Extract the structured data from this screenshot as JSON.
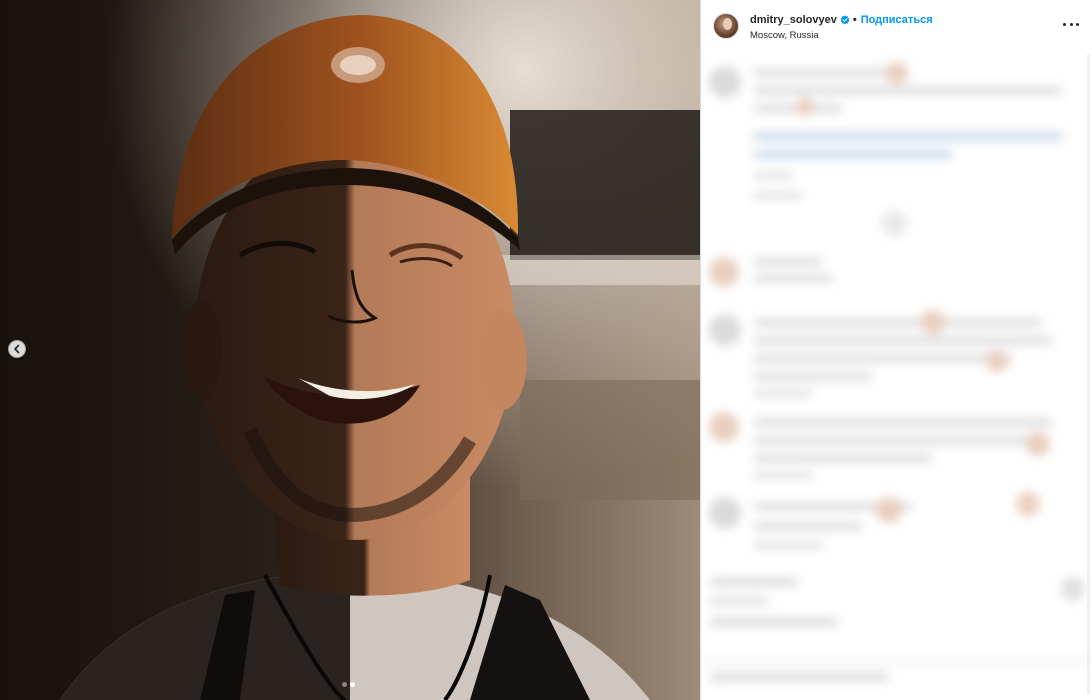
{
  "post": {
    "username": "dmitry_solovyev",
    "separator": "•",
    "follow_label": "Подписаться",
    "location": "Moscow, Russia"
  },
  "carousel": {
    "slide_count": 2,
    "active_slide": 2
  },
  "colors": {
    "accent": "#0095f6",
    "text": "#262626",
    "border": "#dbdbdb"
  },
  "icons": {
    "verified": "verified-badge-icon",
    "more": "more-options-icon",
    "prev": "chevron-left-icon"
  }
}
